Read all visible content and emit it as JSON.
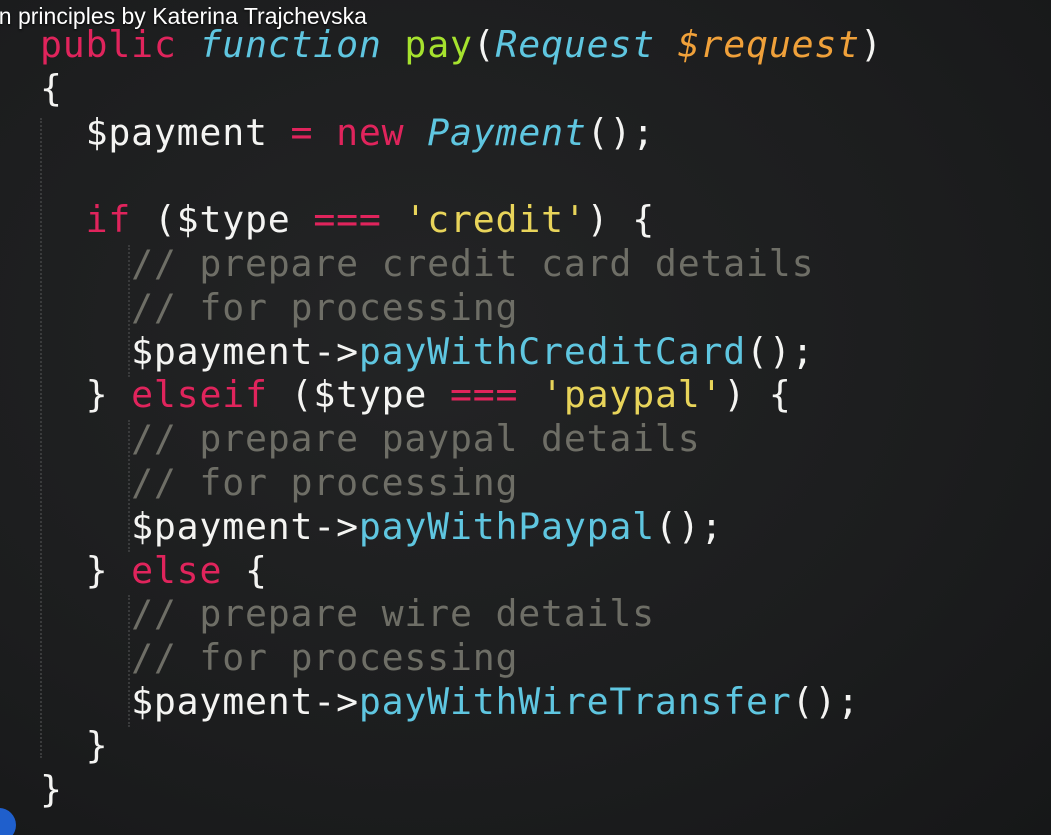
{
  "video": {
    "title": "gn principles by Katerina Trajchevska"
  },
  "code": {
    "l1": {
      "kw1": "public",
      "kw2": "function",
      "name": "pay",
      "p1": "(",
      "cls": "Request",
      "param": "$request",
      "p2": ")"
    },
    "l2": "{",
    "l3": {
      "var": "$payment",
      "eq": "=",
      "new": "new",
      "cls": "Payment",
      "rest": "();"
    },
    "l5": {
      "kw": "if",
      "open": "($type",
      "op": "===",
      "str": "'credit'",
      "close": ") {"
    },
    "l6": "// prepare credit card details",
    "l7": "// for processing",
    "l8": {
      "obj": "$payment->",
      "method": "payWithCreditCard",
      "rest": "();"
    },
    "l9": {
      "brace": "}",
      "kw": "elseif",
      "open": "($type",
      "op": "===",
      "str": "'paypal'",
      "close": ") {"
    },
    "l10": "// prepare paypal details",
    "l11": "// for processing",
    "l12": {
      "obj": "$payment->",
      "method": "payWithPaypal",
      "rest": "();"
    },
    "l13": {
      "brace": "}",
      "kw": "else",
      "open": "{"
    },
    "l14": "// prepare wire details",
    "l15": "// for processing",
    "l16": {
      "obj": "$payment->",
      "method": "payWithWireTransfer",
      "rest": "();"
    },
    "l17": "}",
    "l18": "}"
  }
}
